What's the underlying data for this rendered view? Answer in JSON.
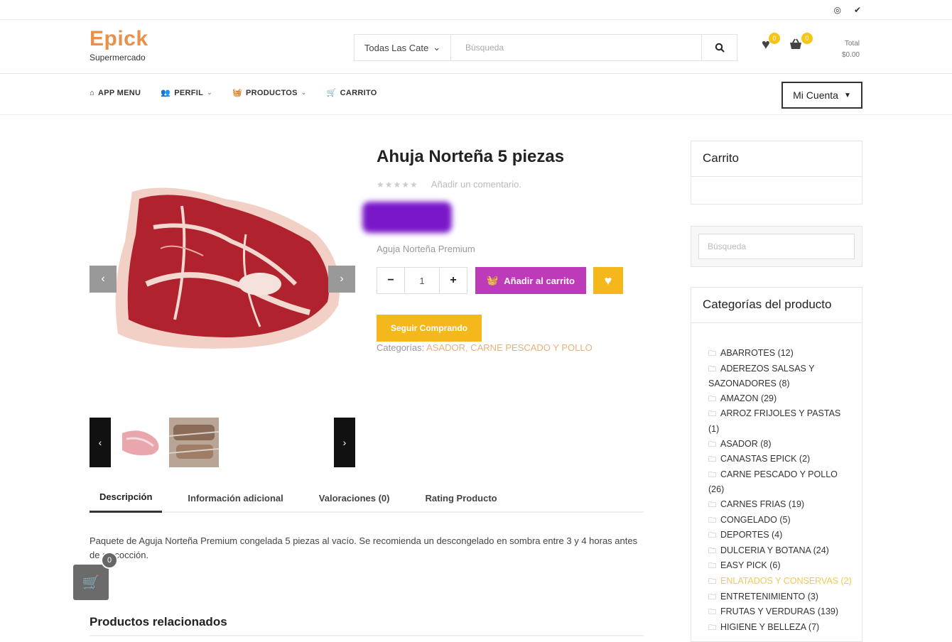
{
  "header": {
    "brand": "Epick",
    "tagline": "Supermercado",
    "category_select": "Todas Las Cate",
    "search_placeholder": "Búsqueda",
    "wishlist_count": "0",
    "cart_count": "0",
    "total_label": "Total",
    "total_value": "$0.00"
  },
  "nav": {
    "items": [
      {
        "label": "APP MENU"
      },
      {
        "label": "PERFIL"
      },
      {
        "label": "PRODUCTOS"
      },
      {
        "label": "CARRITO"
      }
    ],
    "account_label": "Mi Cuenta"
  },
  "product": {
    "title": "Ahuja Norteña 5 piezas",
    "rating_stars": "★★★★★",
    "add_comment": "Añadir un comentario.",
    "short_desc": "Aguja Norteña Premium",
    "quantity": "1",
    "add_to_cart": "Añadir al carrito",
    "continue_shopping": "Seguir Comprando",
    "categories_label": "Categorías:",
    "categories": "ASADOR, CARNE PESCADO Y POLLO"
  },
  "tabs": [
    {
      "label": "Descripción"
    },
    {
      "label": "Información adicional"
    },
    {
      "label": "Valoraciones (0)"
    },
    {
      "label": "Rating Producto"
    }
  ],
  "description": "Paquete de Aguja Norteña Premium congelada 5 piezas al vacío. Se recomienda un descongelado en sombra entre 3 y 4 horas antes de su cocción.",
  "float_cart_count": "0",
  "related_title": "Productos relacionados",
  "sidebar": {
    "cart_title": "Carrito",
    "search_placeholder": "Búsqueda",
    "categories_title": "Categorías del producto",
    "categories": [
      "ABARROTES (12)",
      "ADEREZOS SALSAS Y SAZONADORES (8)",
      "AMAZON (29)",
      "ARROZ FRIJOLES Y PASTAS (1)",
      "ASADOR (8)",
      "CANASTAS EPICK (2)",
      "CARNE PESCADO Y POLLO (26)",
      "CARNES FRIAS (19)",
      "CONGELADO (5)",
      "DEPORTES (4)",
      "DULCERIA Y BOTANA (24)",
      "EASY PICK (6)",
      "ENLATADOS Y CONSERVAS (2)",
      "ENTRETENIMIENTO (3)",
      "FRUTAS Y VERDURAS (139)",
      "HIGIENE Y BELLEZA (7)"
    ]
  },
  "colors": {
    "brand": "#e8914a",
    "add_to_cart": "#bd3ab8",
    "accent_yellow": "#f5b81c"
  }
}
